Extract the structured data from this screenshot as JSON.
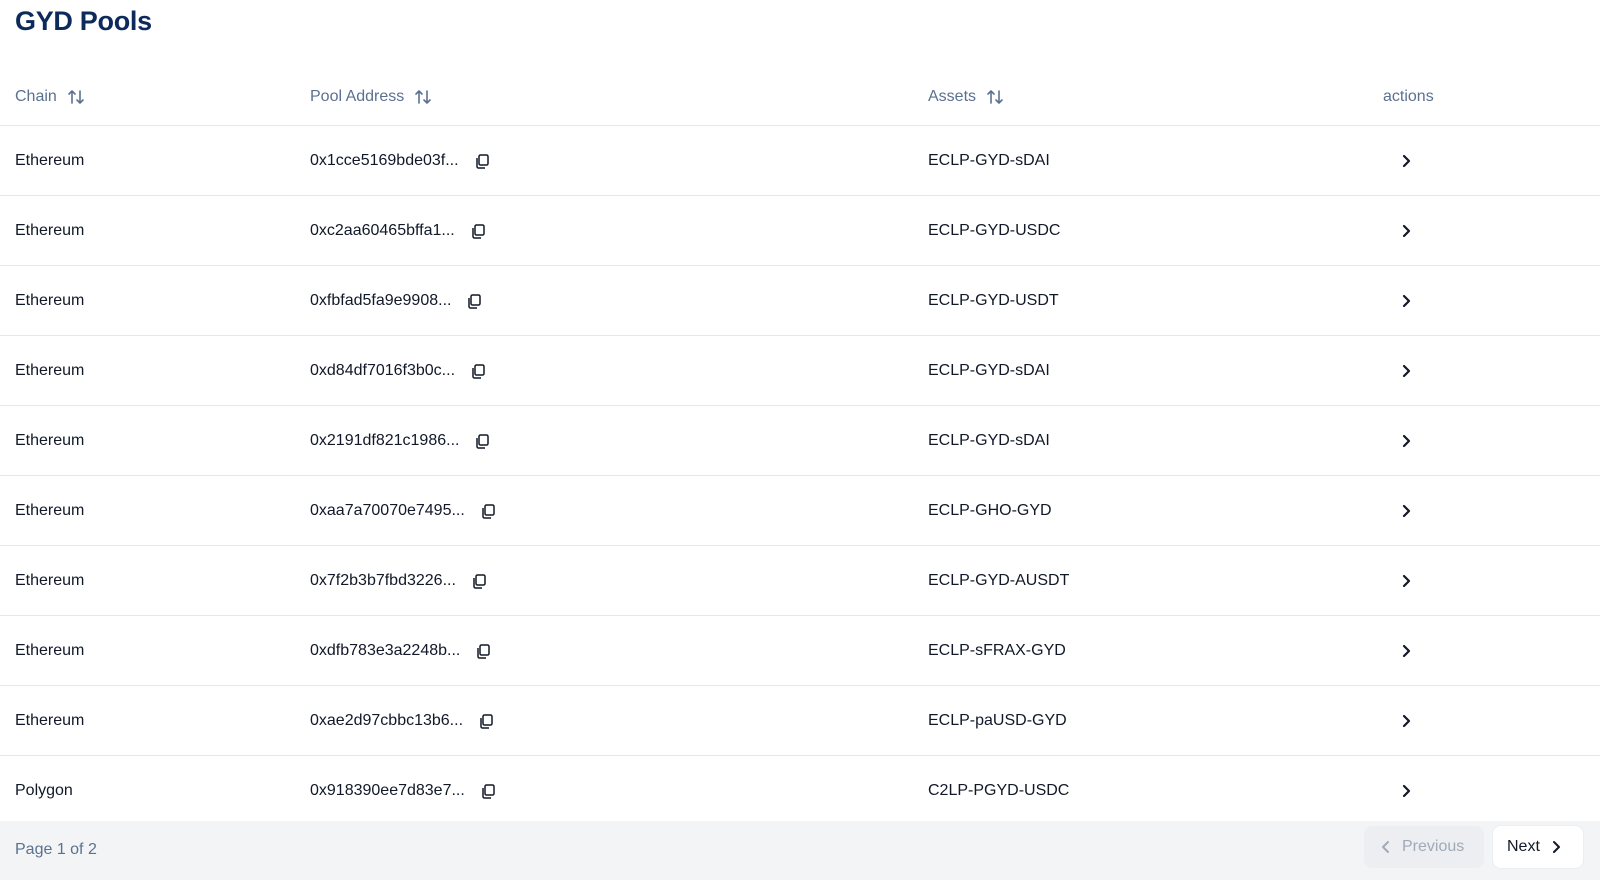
{
  "page": {
    "title": "GYD Pools"
  },
  "table": {
    "headers": {
      "chain": "Chain",
      "pool_address": "Pool Address",
      "assets": "Assets",
      "actions": "actions"
    },
    "rows": [
      {
        "chain": "Ethereum",
        "address": "0x1cce5169bde03f...",
        "assets": "ECLP-GYD-sDAI"
      },
      {
        "chain": "Ethereum",
        "address": "0xc2aa60465bffa1...",
        "assets": "ECLP-GYD-USDC"
      },
      {
        "chain": "Ethereum",
        "address": "0xfbfad5fa9e9908...",
        "assets": "ECLP-GYD-USDT"
      },
      {
        "chain": "Ethereum",
        "address": "0xd84df7016f3b0c...",
        "assets": "ECLP-GYD-sDAI"
      },
      {
        "chain": "Ethereum",
        "address": "0x2191df821c1986...",
        "assets": "ECLP-GYD-sDAI"
      },
      {
        "chain": "Ethereum",
        "address": "0xaa7a70070e7495...",
        "assets": "ECLP-GHO-GYD"
      },
      {
        "chain": "Ethereum",
        "address": "0x7f2b3b7fbd3226...",
        "assets": "ECLP-GYD-AUSDT"
      },
      {
        "chain": "Ethereum",
        "address": "0xdfb783e3a2248b...",
        "assets": "ECLP-sFRAX-GYD"
      },
      {
        "chain": "Ethereum",
        "address": "0xae2d97cbbc13b6...",
        "assets": "ECLP-paUSD-GYD"
      },
      {
        "chain": "Polygon",
        "address": "0x918390ee7d83e7...",
        "assets": "C2LP-PGYD-USDC"
      }
    ]
  },
  "pagination": {
    "info": "Page 1 of 2",
    "previous_label": "Previous",
    "next_label": "Next"
  },
  "icons": {
    "sort": "sort-arrows-icon",
    "copy": "copy-icon",
    "row_action": "chevron-right-icon",
    "prev": "chevron-left-icon",
    "next": "chevron-right-icon"
  },
  "colors": {
    "title": "#0c2a5b",
    "header_text": "#5b7190",
    "border": "#e5e7eb",
    "footer_bg": "#f3f4f6"
  }
}
